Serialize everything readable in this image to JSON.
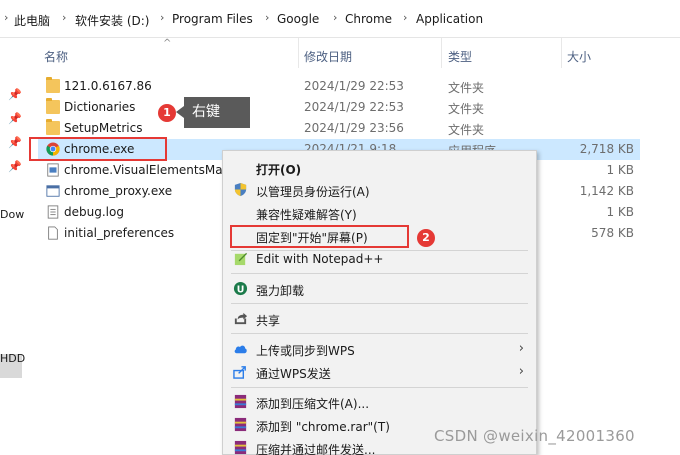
{
  "breadcrumb": [
    "此电脑",
    "软件安装 (D:)",
    "Program Files",
    "Google",
    "Chrome",
    "Application"
  ],
  "left_pane": {
    "text1": "Dow",
    "text2": "HDD"
  },
  "columns": {
    "name": "名称",
    "date": "修改日期",
    "type": "类型",
    "size": "大小"
  },
  "files": [
    {
      "name": "121.0.6167.86",
      "date": "2024/1/29 22:53",
      "type": "文件夹",
      "size": "",
      "icon": "folder-icon"
    },
    {
      "name": "Dictionaries",
      "date": "2024/1/29 22:53",
      "type": "文件夹",
      "size": "",
      "icon": "folder-icon"
    },
    {
      "name": "SetupMetrics",
      "date": "2024/1/29 23:56",
      "type": "文件夹",
      "size": "",
      "icon": "folder-icon"
    },
    {
      "name": "chrome.exe",
      "date": "2024/1/21 9:18",
      "type": "应用程序",
      "size": "2,718 KB",
      "icon": "chrome-icon",
      "selected": true
    },
    {
      "name": "chrome.VisualElementsMani",
      "date": "",
      "type": "",
      "size": "1 KB",
      "icon": "xml-icon"
    },
    {
      "name": "chrome_proxy.exe",
      "date": "",
      "type": "",
      "size": "1,142 KB",
      "icon": "exe-icon"
    },
    {
      "name": "debug.log",
      "date": "",
      "type": "",
      "size": "1 KB",
      "icon": "text-file-icon"
    },
    {
      "name": "initial_preferences",
      "date": "",
      "type": "",
      "size": "578 KB",
      "icon": "file-icon"
    }
  ],
  "annotations": {
    "step1": "1",
    "step1_label": "右键",
    "step2": "2"
  },
  "context_menu": [
    {
      "label": "打开(O)",
      "icon": "",
      "bold": true
    },
    {
      "label": "以管理员身份运行(A)",
      "icon": "shield-icon"
    },
    {
      "label": "兼容性疑难解答(Y)",
      "icon": ""
    },
    {
      "label": "固定到\"开始\"屏幕(P)",
      "icon": ""
    },
    {
      "label": "Edit with Notepad++",
      "icon": "notepad-plus-icon"
    },
    {
      "label": "强力卸载",
      "icon": "uninstall-icon"
    },
    {
      "label": "共享",
      "icon": "share-icon"
    },
    {
      "label": "上传或同步到WPS",
      "icon": "cloud-icon",
      "submenu": true
    },
    {
      "label": "通过WPS发送",
      "icon": "send-icon",
      "submenu": true
    },
    {
      "label": "添加到压缩文件(A)...",
      "icon": "winrar-icon"
    },
    {
      "label": "添加到 \"chrome.rar\"(T)",
      "icon": "winrar-icon"
    },
    {
      "label": "压缩并通过邮件发送...",
      "icon": "winrar-icon"
    }
  ],
  "watermark": "CSDN @weixin_42001360"
}
